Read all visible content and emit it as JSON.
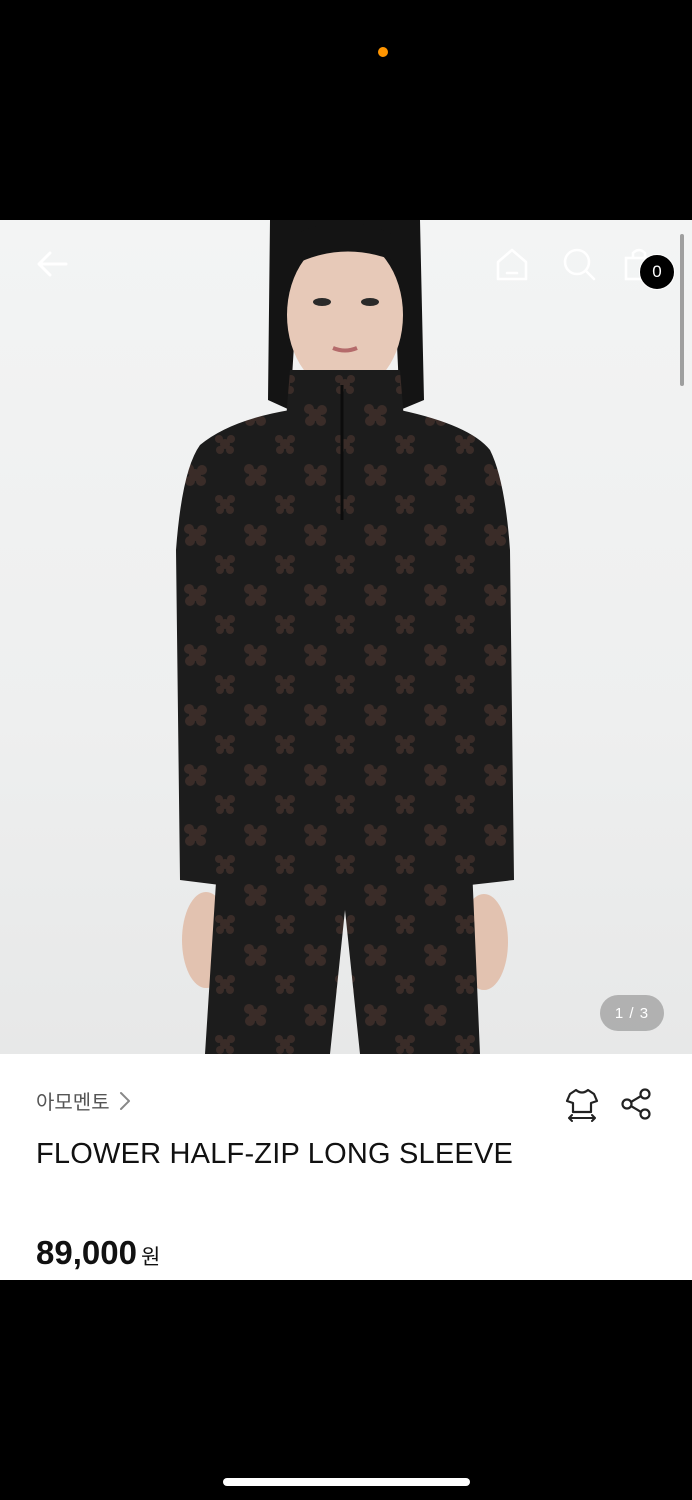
{
  "status_bar": {
    "indicator_color": "#ff9500"
  },
  "header": {
    "back_icon": "arrow-left-icon",
    "home_icon": "home-icon",
    "search_icon": "search-icon",
    "cart_icon": "shopping-bag-icon",
    "cart_count": "0"
  },
  "gallery": {
    "pager": "1 / 3"
  },
  "product": {
    "brand": "아모멘토",
    "title": "FLOWER HALF-ZIP LONG SLEEVE",
    "price": "89,000",
    "currency": "원",
    "size_icon": "size-guide-shirt-icon",
    "share_icon": "share-icon"
  },
  "colors": {
    "page_bg": "#000000",
    "info_bg": "#ffffff",
    "text_primary": "#111111",
    "text_secondary": "#555555",
    "status_dot": "#ff9500"
  }
}
